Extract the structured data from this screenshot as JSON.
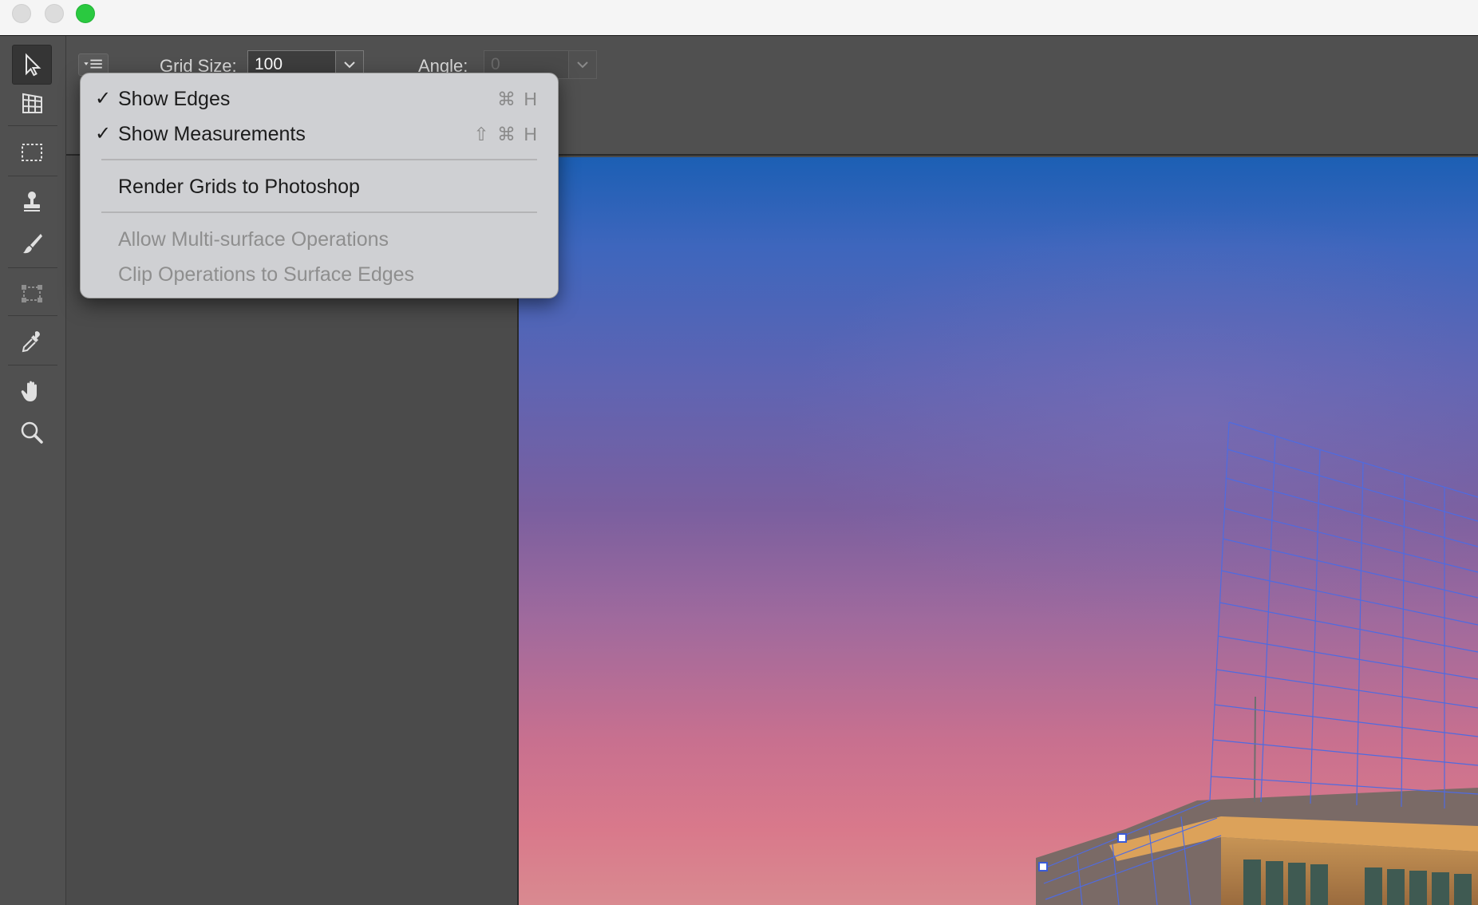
{
  "window": {
    "controls": [
      "close",
      "minimize",
      "zoom"
    ]
  },
  "tools": [
    {
      "name": "selection-tool-icon"
    },
    {
      "name": "create-plane-tool-icon"
    },
    {
      "name": "marquee-tool-icon"
    },
    {
      "name": "stamp-tool-icon"
    },
    {
      "name": "brush-tool-icon"
    },
    {
      "name": "transform-tool-icon"
    },
    {
      "name": "eyedropper-tool-icon"
    },
    {
      "name": "hand-tool-icon"
    },
    {
      "name": "zoom-tool-icon"
    }
  ],
  "options": {
    "grid_size_label": "Grid Size:",
    "grid_size_value": "100",
    "angle_label": "Angle:",
    "angle_value": "0"
  },
  "menu": {
    "show_edges": {
      "label": "Show Edges",
      "checked": "✓",
      "shortcut": "⌘ H"
    },
    "show_measurements": {
      "label": "Show Measurements",
      "checked": "✓",
      "shortcut": "⇧ ⌘ H"
    },
    "render_grids": {
      "label": "Render Grids to Photoshop"
    },
    "allow_multi": {
      "label": "Allow Multi-surface Operations"
    },
    "clip_operations": {
      "label": "Clip Operations to Surface Edges"
    }
  },
  "colors": {
    "accent_window_zoom": "#2ac940",
    "grid_lines": "#4f6be0"
  }
}
